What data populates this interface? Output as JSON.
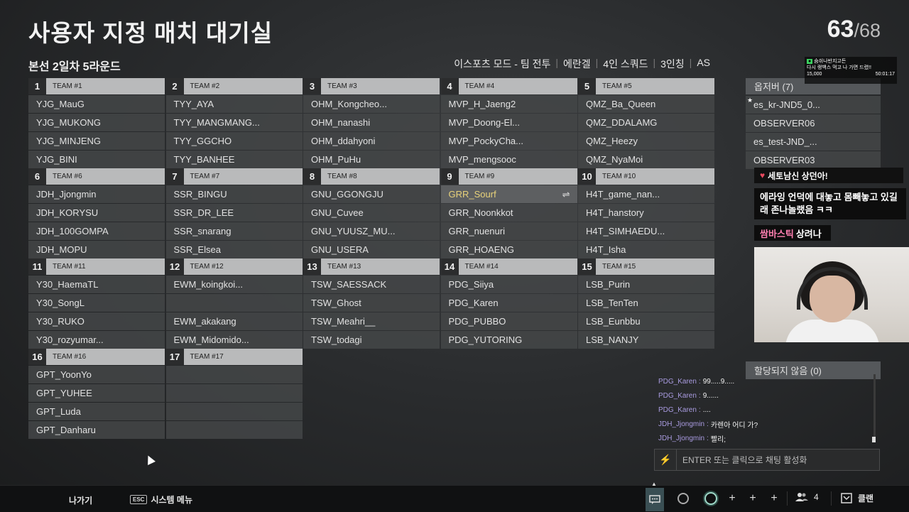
{
  "header": {
    "title": "사용자 지정 매치 대기실",
    "player_count": "63",
    "player_total": "/68",
    "subtitle": "본선 2일차 5라운드",
    "modes": [
      "이스포츠 모드 - 팀 전투",
      "에란겔",
      "4인 스쿼드",
      "3인칭",
      "AS"
    ]
  },
  "teams": [
    {
      "num": "1",
      "label": "TEAM #1",
      "players": [
        "YJG_MauG",
        "YJG_MUKONG",
        "YJG_MINJENG",
        "YJG_BINI"
      ]
    },
    {
      "num": "2",
      "label": "TEAM #2",
      "players": [
        "TYY_AYA",
        "TYY_MANGMANG...",
        "TYY_GGCHO",
        "TYY_BANHEE"
      ]
    },
    {
      "num": "3",
      "label": "TEAM #3",
      "players": [
        "OHM_Kongcheo...",
        "OHM_nanashi",
        "OHM_ddahyoni",
        "OHM_PuHu"
      ]
    },
    {
      "num": "4",
      "label": "TEAM #4",
      "players": [
        "MVP_H_Jaeng2",
        "MVP_Doong-El...",
        "MVP_PockyCha...",
        "MVP_mengsooc"
      ]
    },
    {
      "num": "5",
      "label": "TEAM #5",
      "players": [
        "QMZ_Ba_Queen",
        "QMZ_DDALAMG",
        "QMZ_Heezy",
        "QMZ_NyaMoi"
      ]
    },
    {
      "num": "6",
      "label": "TEAM #6",
      "players": [
        "JDH_Jjongmin",
        "JDH_KORYSU",
        "JDH_100GOMPA",
        "JDH_MOPU"
      ]
    },
    {
      "num": "7",
      "label": "TEAM #7",
      "players": [
        "SSR_BINGU",
        "SSR_DR_LEE",
        "SSR_snarang",
        "SSR_Elsea"
      ]
    },
    {
      "num": "8",
      "label": "TEAM #8",
      "players": [
        "GNU_GGONGJU",
        "GNU_Cuvee",
        "GNU_YUUSZ_MU...",
        "GNU_USERA"
      ]
    },
    {
      "num": "9",
      "label": "TEAM #9",
      "players": [
        "GRR_Sourf",
        "GRR_Noonkkot",
        "GRR_nuenuri",
        "GRR_HOAENG"
      ]
    },
    {
      "num": "10",
      "label": "TEAM #10",
      "players": [
        "H4T_game_nan...",
        "H4T_hanstory",
        "H4T_SIMHAEDU...",
        "H4T_Isha"
      ]
    },
    {
      "num": "11",
      "label": "TEAM #11",
      "players": [
        "Y30_HaemaTL",
        "Y30_SongL",
        "Y30_RUKO",
        "Y30_rozyumar..."
      ]
    },
    {
      "num": "12",
      "label": "TEAM #12",
      "players": [
        "EWM_koingkoi...",
        "",
        "EWM_akakang",
        "EWM_Midomido..."
      ]
    },
    {
      "num": "13",
      "label": "TEAM #13",
      "players": [
        "TSW_SAESSACK",
        "TSW_Ghost",
        "TSW_Meahri__",
        "TSW_todagi"
      ]
    },
    {
      "num": "14",
      "label": "TEAM #14",
      "players": [
        "PDG_Siiya",
        "PDG_Karen",
        "PDG_PUBBO",
        "PDG_YUTORING"
      ]
    },
    {
      "num": "15",
      "label": "TEAM #15",
      "players": [
        "LSB_Purin",
        "LSB_TenTen",
        "LSB_Eunbbu",
        "LSB_NANJY"
      ]
    },
    {
      "num": "16",
      "label": "TEAM #16",
      "players": [
        "GPT_YoonYo",
        "GPT_YUHEE",
        "GPT_Luda",
        "GPT_Danharu"
      ]
    },
    {
      "num": "17",
      "label": "TEAM #17",
      "players": [
        "",
        "",
        "",
        ""
      ]
    }
  ],
  "highlight": {
    "team_index": 8,
    "slot_index": 0,
    "swap_icon": "⇌"
  },
  "observers": {
    "header": "옵저버 (7)",
    "items": [
      "es_kr-JND5_0...",
      "OBSERVER06",
      "es_test-JND_...",
      "OBSERVER03"
    ]
  },
  "stream_overlay": {
    "donation": "세토남신 상던아!",
    "chat_popup": "에라잉 언덕에 대놓고 몸빼놓고 있길래 존나놀랬음 ㅋㅋ",
    "name_popup_name": "쌈바스틱",
    "name_popup_msg": "상려나",
    "mini_line1": "숨쉬나반지고든",
    "mini_line2": "다시 랭백스 먹고 나 가면 드렸!!",
    "mini_line3": "15,000",
    "mini_time": "50:01:17"
  },
  "unassigned": {
    "header": "할당되지 않음 (0)"
  },
  "chat": {
    "messages": [
      {
        "who": "PDG_Karen",
        "msg": "99.....9....."
      },
      {
        "who": "PDG_Karen",
        "msg": "9......"
      },
      {
        "who": "PDG_Karen",
        "msg": "...."
      },
      {
        "who": "JDH_Jjongmin",
        "msg": "카렌아 어디 가?"
      },
      {
        "who": "JDH_Jjongmin",
        "msg": "빨리;"
      }
    ],
    "input_placeholder": "ENTER 또는 클릭으로 채팅 활성화"
  },
  "bottom": {
    "exit_label": "나가기",
    "esc_key": "ESC",
    "menu_label": "시스템 메뉴",
    "party_count": "4",
    "clan_label": "클랜"
  },
  "colors": {
    "highlight_text": "#e8d27a",
    "chat_name": "#a99be0"
  }
}
